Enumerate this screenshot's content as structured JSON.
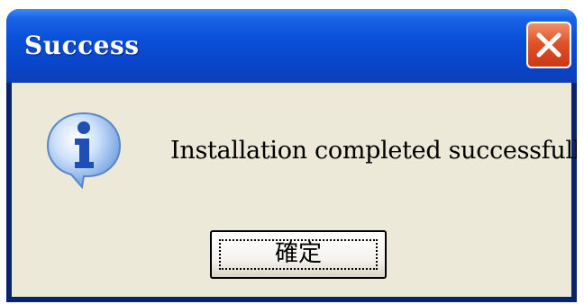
{
  "dialog": {
    "title": "Success",
    "message": "Installation completed successfully",
    "ok_label": "確定"
  },
  "icons": {
    "close": "close-icon",
    "info": "info-icon"
  },
  "colors": {
    "titlebar": "#0a50d8",
    "close_button": "#e0522a",
    "client": "#ece9d8",
    "info_icon": "#2a6fd6"
  }
}
